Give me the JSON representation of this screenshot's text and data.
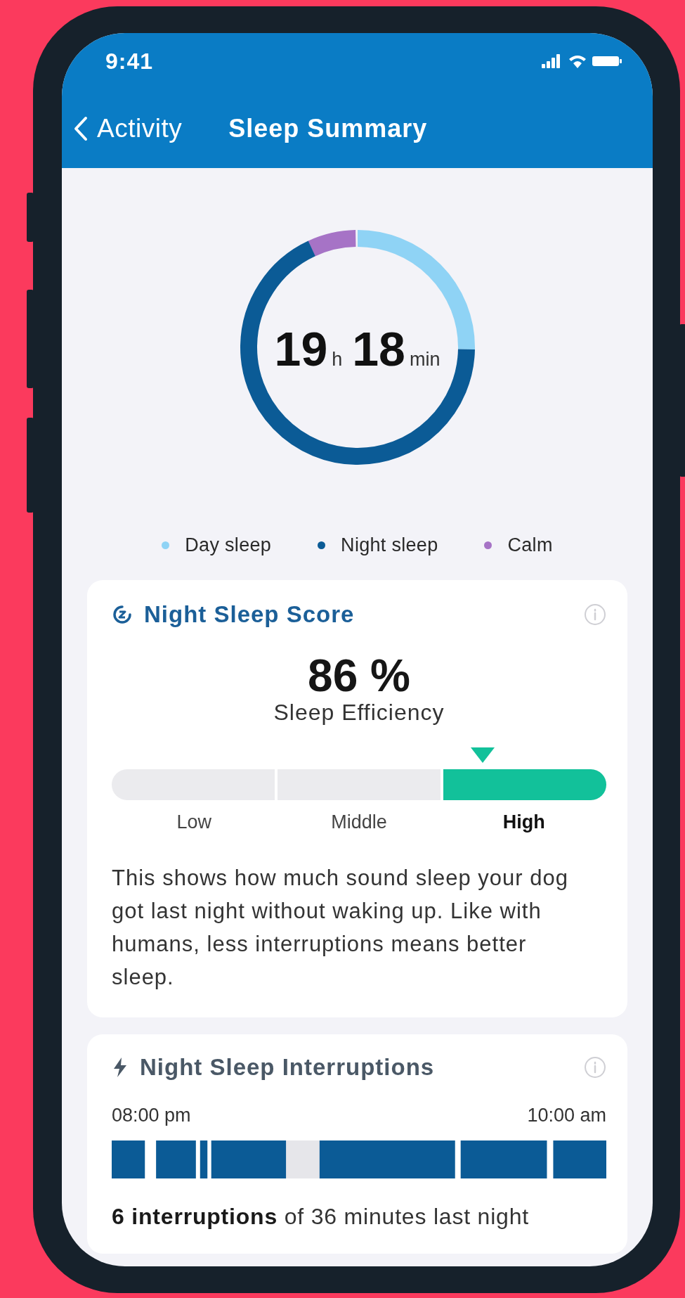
{
  "status_bar": {
    "time": "9:41"
  },
  "nav": {
    "back_label": "Activity",
    "title": "Sleep Summary"
  },
  "total": {
    "hours": "19",
    "hours_unit": "h",
    "minutes": "18",
    "minutes_unit": "min"
  },
  "legend": [
    {
      "label": "Day sleep",
      "color": "#8fd3f5"
    },
    {
      "label": "Night sleep",
      "color": "#0b5b96"
    },
    {
      "label": "Calm",
      "color": "#a673c6"
    }
  ],
  "score_card": {
    "title": "Night Sleep Score",
    "value": "86 %",
    "caption": "Sleep Efficiency",
    "level": 0.75,
    "levels": [
      {
        "label": "Low",
        "selected": false
      },
      {
        "label": "Middle",
        "selected": false
      },
      {
        "label": "High",
        "selected": true
      }
    ],
    "description": "This shows how much sound sleep your dog got last night without waking up. Like with humans, less interruptions means better sleep."
  },
  "interruptions_card": {
    "title": "Night Sleep Interruptions",
    "start_time": "08:00 pm",
    "end_time": "10:00 am",
    "summary": "**6 interruptions** of 36 minutes last night"
  }
}
